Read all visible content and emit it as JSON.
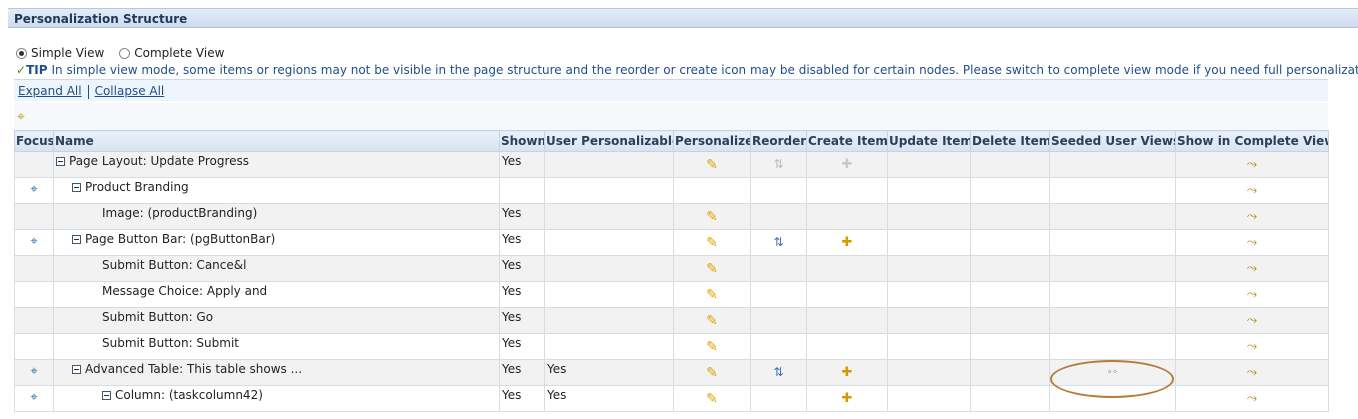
{
  "section": {
    "title": "Personalization Structure"
  },
  "view_options": [
    {
      "label": "Simple View",
      "selected": true
    },
    {
      "label": "Complete View",
      "selected": false
    }
  ],
  "tip": {
    "label": "TIP",
    "text": "In simple view mode, some items or regions may not be visible in the page structure and the reorder or create icon may be disabled for certain nodes. Please switch to complete view mode if you need full personalization capabili"
  },
  "actions": {
    "expand_all": "Expand All",
    "collapse_all": "Collapse All"
  },
  "columns": [
    "Focus",
    "Name",
    "Shown",
    "User Personalizable",
    "Personalize",
    "Reorder",
    "Create Item",
    "Update Item",
    "Delete Item",
    "Seeded User Views",
    "Show in Complete View"
  ],
  "rows": [
    {
      "name": "Page Layout: Update Progress",
      "level": 0,
      "collapsible": true,
      "focus": false,
      "shown": "Yes",
      "user_personalizable": "",
      "personalize": true,
      "reorder": "disabled",
      "create": "disabled",
      "seeded": false
    },
    {
      "name": "Product Branding",
      "level": 1,
      "collapsible": true,
      "focus": true,
      "shown": "",
      "user_personalizable": "",
      "personalize": false,
      "reorder": "none",
      "create": "none",
      "seeded": false
    },
    {
      "name": "Image: (productBranding)",
      "level": 2,
      "collapsible": false,
      "focus": false,
      "shown": "Yes",
      "user_personalizable": "",
      "personalize": true,
      "reorder": "none",
      "create": "none",
      "seeded": false
    },
    {
      "name": "Page Button Bar: (pgButtonBar)",
      "level": 1,
      "collapsible": true,
      "focus": true,
      "shown": "Yes",
      "user_personalizable": "",
      "personalize": true,
      "reorder": "enabled",
      "create": "enabled",
      "seeded": false
    },
    {
      "name": "Submit Button: Cance&l",
      "level": 2,
      "collapsible": false,
      "focus": false,
      "shown": "Yes",
      "user_personalizable": "",
      "personalize": true,
      "reorder": "none",
      "create": "none",
      "seeded": false
    },
    {
      "name": "Message Choice: Apply and",
      "level": 2,
      "collapsible": false,
      "focus": false,
      "shown": "Yes",
      "user_personalizable": "",
      "personalize": true,
      "reorder": "none",
      "create": "none",
      "seeded": false
    },
    {
      "name": "Submit Button: Go",
      "level": 2,
      "collapsible": false,
      "focus": false,
      "shown": "Yes",
      "user_personalizable": "",
      "personalize": true,
      "reorder": "none",
      "create": "none",
      "seeded": false
    },
    {
      "name": "Submit Button: Submit",
      "level": 2,
      "collapsible": false,
      "focus": false,
      "shown": "Yes",
      "user_personalizable": "",
      "personalize": true,
      "reorder": "none",
      "create": "none",
      "seeded": false
    },
    {
      "name": "Advanced Table: This table shows ...",
      "level": 1,
      "collapsible": true,
      "focus": true,
      "shown": "Yes",
      "user_personalizable": "Yes",
      "personalize": true,
      "reorder": "enabled",
      "create": "enabled",
      "seeded": true
    },
    {
      "name": "Column: (taskcolumn42)",
      "level": 2,
      "collapsible": true,
      "focus": true,
      "shown": "Yes",
      "user_personalizable": "Yes",
      "personalize": true,
      "reorder": "none",
      "create": "enabled",
      "seeded": false
    }
  ],
  "icons": {
    "focus": "focus-crosshair-icon",
    "personalize": "pencil-icon",
    "reorder": "reorder-icon",
    "create": "create-item-icon",
    "seeded": "glasses-icon",
    "complete_view": "show-complete-view-icon"
  },
  "colors": {
    "header_bg": "#d8e3f0",
    "link": "#1f4f88",
    "highlight_ellipse": "#b77a3a"
  }
}
